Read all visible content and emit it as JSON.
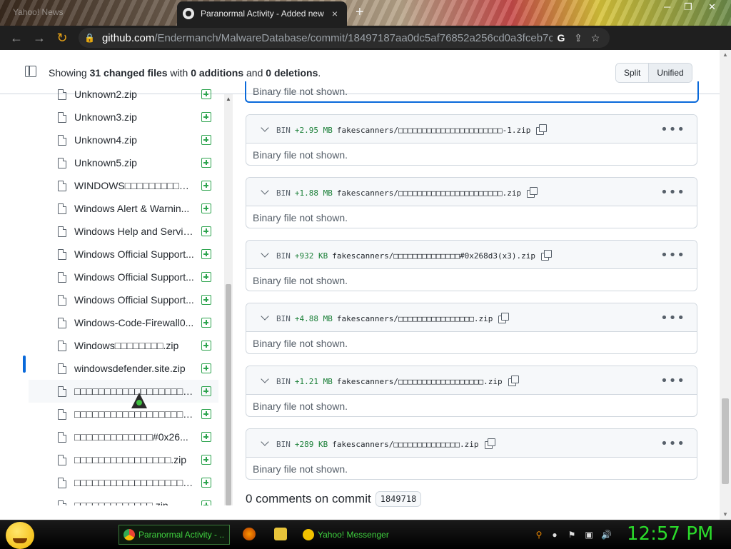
{
  "browser": {
    "inactive_tab_title": "Yahoo! News",
    "active_tab_title": "Paranormal Activity - Added new",
    "url_host": "github.com",
    "url_path": "/Endermanch/MalwareDatabase/commit/18497187aa0dc5af76852a256cd0a3fceb7c4...",
    "new_tab_label": "+",
    "close_tab_label": "×"
  },
  "summary": {
    "prefix": "Showing ",
    "changed_count": "31 changed files",
    "mid1": " with ",
    "additions": "0 additions",
    "mid2": " and ",
    "deletions": "0 deletions",
    "suffix": "."
  },
  "view_switch": {
    "split": "Split",
    "unified": "Unified"
  },
  "file_tree": [
    "Unknown2.zip",
    "Unknown3.zip",
    "Unknown4.zip",
    "Unknown5.zip",
    "WINDOWS□□□□□□□□□□□...",
    "Windows Alert & Warnin...",
    "Windows Help and Servic...",
    "Windows Official Support...",
    "Windows Official Support...",
    "Windows Official Support...",
    "Windows-Code-Firewall0...",
    "Windows□□□□□□□□.zip",
    "windowsdefender.site.zip",
    "□□□□□□□□□□□□□□□□□□□...",
    "□□□□□□□□□□□□□□□□□□□...",
    "□□□□□□□□□□□□□#0x26...",
    "□□□□□□□□□□□□□□□□.zip",
    "□□□□□□□□□□□□□□□□□□□...",
    "□□□□□□□□□□□□□.zip"
  ],
  "prev_body": "Binary file not shown.",
  "diffs": [
    {
      "bin": "BIN",
      "size": "+2.95 MB",
      "path": "fakescanners/□□□□□□□□□□□□□□□□□□□□□□-1.zip",
      "body": "Binary file not shown."
    },
    {
      "bin": "BIN",
      "size": "+1.88 MB",
      "path": "fakescanners/□□□□□□□□□□□□□□□□□□□□□□.zip",
      "body": "Binary file not shown."
    },
    {
      "bin": "BIN",
      "size": "+932 KB",
      "path": "fakescanners/□□□□□□□□□□□□□□#0x268d3(x3).zip",
      "body": "Binary file not shown."
    },
    {
      "bin": "BIN",
      "size": "+4.88 MB",
      "path": "fakescanners/□□□□□□□□□□□□□□□□.zip",
      "body": "Binary file not shown."
    },
    {
      "bin": "BIN",
      "size": "+1.21 MB",
      "path": "fakescanners/□□□□□□□□□□□□□□□□□□.zip",
      "body": "Binary file not shown."
    },
    {
      "bin": "BIN",
      "size": "+289 KB",
      "path": "fakescanners/□□□□□□□□□□□□□□.zip",
      "body": "Binary file not shown."
    }
  ],
  "comments": {
    "text": "0 comments on commit",
    "sha": "1849718"
  },
  "taskbar": {
    "chrome_task": "Paranormal Activity - ...",
    "messenger_task": "Yahoo! Messenger",
    "clock": "12:57 PM"
  },
  "colors": {
    "accent": "#0969da",
    "added": "#1a7f37",
    "clock": "#2bdc2b"
  }
}
